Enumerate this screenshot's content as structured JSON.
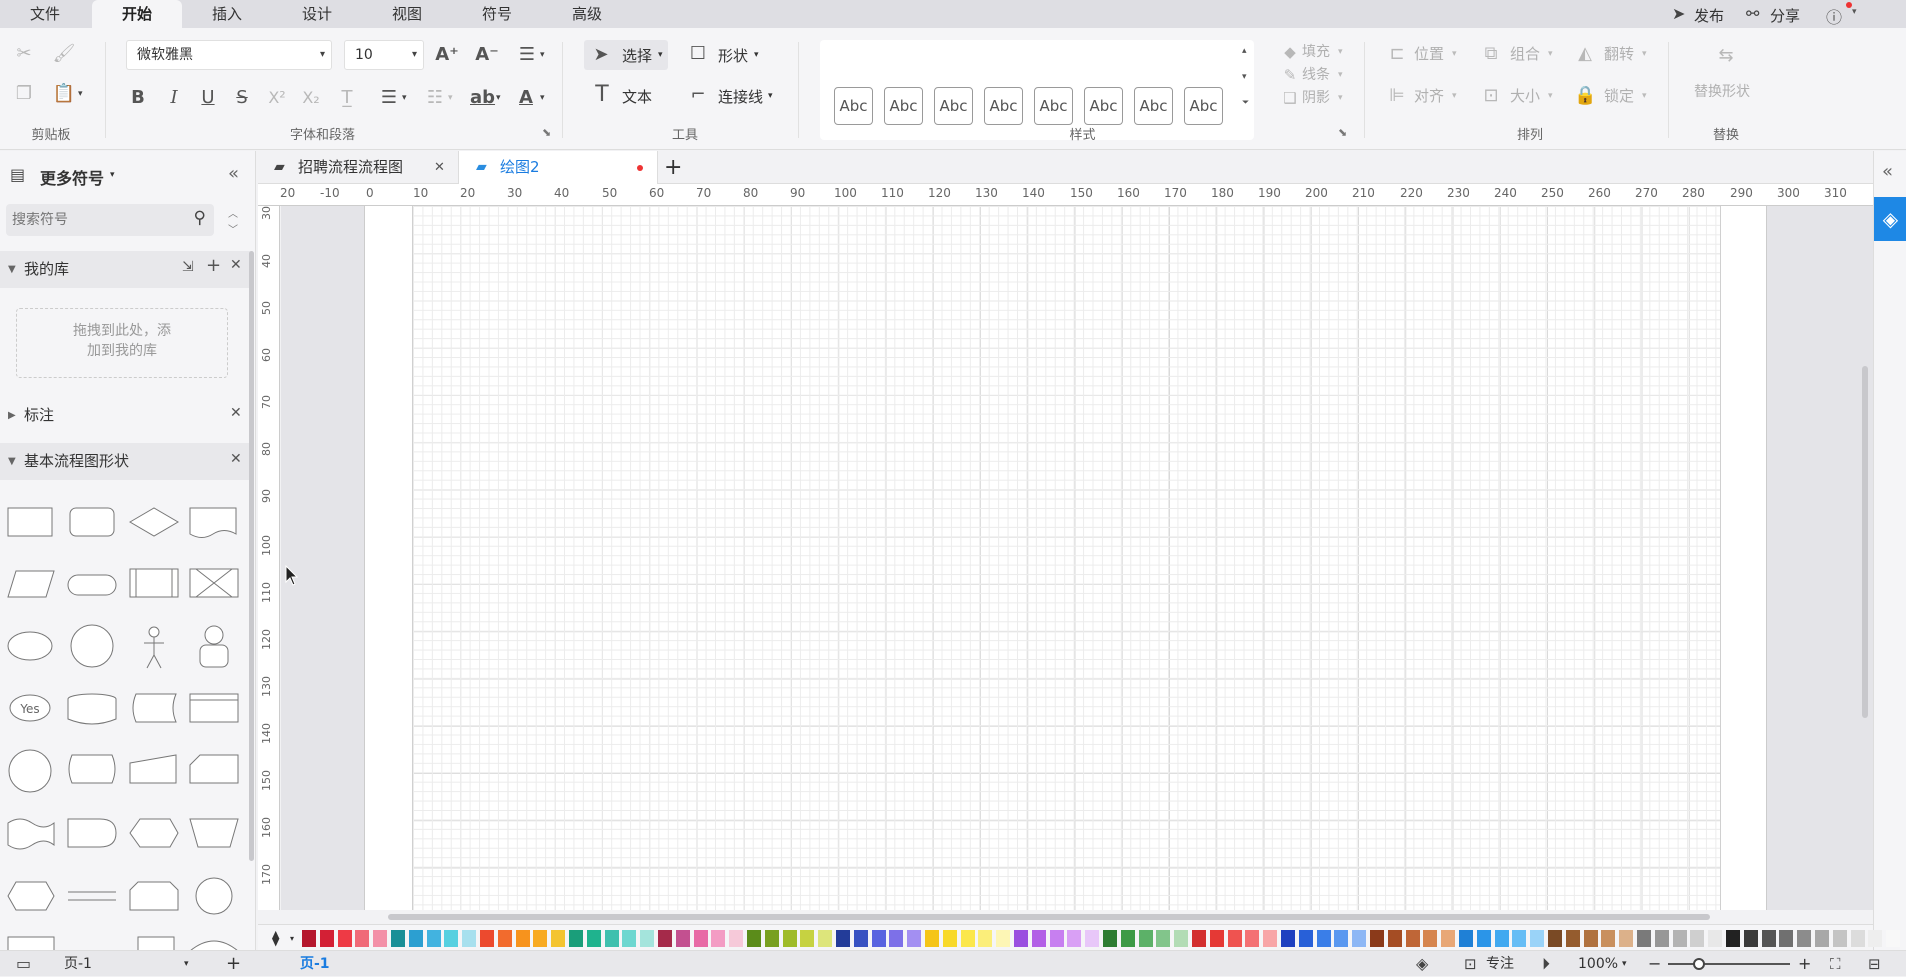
{
  "menu": {
    "tabs": [
      "文件",
      "开始",
      "插入",
      "设计",
      "视图",
      "符号",
      "高级"
    ],
    "active": "开始",
    "right": {
      "publish": "发布",
      "share": "分享"
    }
  },
  "ribbon": {
    "clipboard": {
      "group_label": "剪贴板"
    },
    "font": {
      "family": "微软雅黑",
      "size": "10",
      "group_label": "字体和段落"
    },
    "tools": {
      "select": "选择",
      "shape": "形状",
      "text": "文本",
      "connector": "连接线",
      "group_label": "工具"
    },
    "styles": {
      "swatch_label": "Abc",
      "count": 8,
      "group_label": "样式"
    },
    "style_opts": {
      "fill": "填充",
      "line": "线条",
      "shadow": "阴影"
    },
    "arrange": {
      "position": "位置",
      "group": "组合",
      "flip": "翻转",
      "align": "对齐",
      "size": "大小",
      "lock": "锁定",
      "group_label": "排列"
    },
    "replace": {
      "label": "替换形状",
      "group_label": "替换"
    }
  },
  "sidebar": {
    "title": "更多符号",
    "search_placeholder": "搜索符号",
    "my_library": "我的库",
    "drop_hint_1": "拖拽到此处，添",
    "drop_hint_2": "加到我的库",
    "annotations": "标注",
    "basic_flowchart": "基本流程图形状",
    "yes_label": "Yes"
  },
  "documents": {
    "tabs": [
      {
        "label": "招聘流程流程图",
        "active": false
      },
      {
        "label": "绘图2",
        "active": true
      }
    ]
  },
  "ruler": {
    "top": [
      "20",
      "-10",
      "0",
      "10",
      "20",
      "30",
      "40",
      "50",
      "60",
      "70",
      "80",
      "90",
      "100",
      "110",
      "120",
      "130",
      "140",
      "150",
      "160",
      "170",
      "180",
      "190",
      "200",
      "210",
      "220",
      "230",
      "240",
      "250",
      "260",
      "270",
      "280",
      "290",
      "300",
      "310"
    ],
    "left": [
      "30",
      "40",
      "50",
      "60",
      "70",
      "80",
      "90",
      "100",
      "110",
      "120",
      "130",
      "140",
      "150",
      "160",
      "170"
    ]
  },
  "palette": [
    "#b5172d",
    "#d32035",
    "#ee3a45",
    "#f06a78",
    "#f390a8",
    "#1a8f97",
    "#2c9fd1",
    "#42b3e0",
    "#56d0e0",
    "#a7e0ee",
    "#ec4a2e",
    "#f26b2d",
    "#f7931d",
    "#f8aa22",
    "#f4c430",
    "#1a9e7a",
    "#1fb38e",
    "#3fc0ae",
    "#6dd7d0",
    "#a4e4dc",
    "#a52a4a",
    "#c35090",
    "#e86aa6",
    "#f39cc4",
    "#f6c9d9",
    "#5b8c1a",
    "#78a020",
    "#9fbb28",
    "#c6d241",
    "#dde57b",
    "#233c99",
    "#3852c2",
    "#5863e0",
    "#7d70e8",
    "#a38ff2",
    "#f5c518",
    "#f8d92a",
    "#fbe74b",
    "#fbee7a",
    "#fdf6b5",
    "#9a4fe0",
    "#b25fe6",
    "#c77ff0",
    "#d9a0f5",
    "#e8c7f9",
    "#2e7d32",
    "#3d9a46",
    "#5cb168",
    "#82c58b",
    "#b2dcb5",
    "#d32f2f",
    "#e53935",
    "#ef5350",
    "#f47174",
    "#f8a5a7",
    "#1e40c0",
    "#2860d8",
    "#3a7ee8",
    "#5a98f0",
    "#8db7f5",
    "#8b3a1a",
    "#a54d24",
    "#bf6637",
    "#d6854f",
    "#e8a776",
    "#1f80d6",
    "#2b95e8",
    "#41a9f0",
    "#66bdf5",
    "#9ad3f8",
    "#7a4a25",
    "#955c2e",
    "#b0723f",
    "#c9905e",
    "#dcb18a",
    "#7a7a7a",
    "#979797",
    "#b3b3b3",
    "#cfcfcf",
    "#e8e8e8",
    "#222222",
    "#3a3a3a",
    "#555555",
    "#707070",
    "#8c8c8c",
    "#a8a8a8",
    "#c4c4c4",
    "#dcdcdc",
    "#eeeeee",
    "#f8f8f8"
  ],
  "status": {
    "page_select": "页-1",
    "page_tab": "页-1",
    "focus": "专注",
    "zoom": "100%"
  }
}
